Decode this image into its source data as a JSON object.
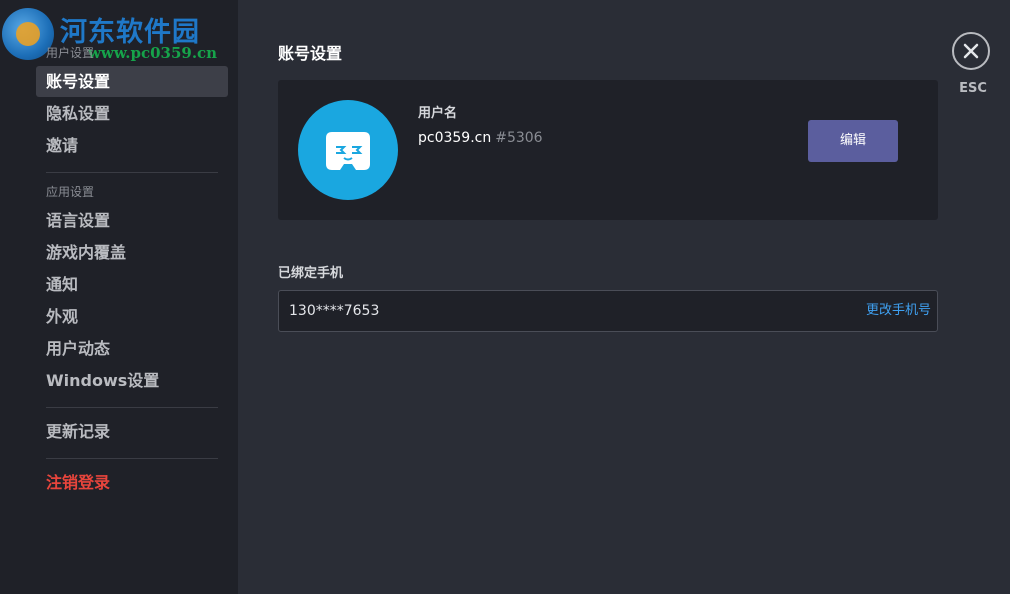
{
  "watermark": {
    "title": "河东软件园",
    "url": "www.pc0359.cn"
  },
  "sidebar": {
    "user_section": "用户设置",
    "app_section": "应用设置",
    "items": [
      {
        "label": "账号设置"
      },
      {
        "label": "隐私设置"
      },
      {
        "label": "邀请"
      },
      {
        "label": "语言设置"
      },
      {
        "label": "游戏内覆盖"
      },
      {
        "label": "通知"
      },
      {
        "label": "外观"
      },
      {
        "label": "用户动态"
      },
      {
        "label": "Windows设置"
      },
      {
        "label": "更新记录"
      },
      {
        "label": "注销登录"
      }
    ]
  },
  "main": {
    "title": "账号设置",
    "profile": {
      "username_label": "用户名",
      "username": "pc0359.cn",
      "discriminator": "#5306",
      "edit_label": "编辑"
    },
    "phone": {
      "label": "已绑定手机",
      "value": "130****7653",
      "change_label": "更改手机号"
    },
    "esc_label": "ESC"
  },
  "colors": {
    "sidebar_bg": "#1f2128",
    "main_bg": "#2a2d36",
    "accent_button": "#5b5e9e",
    "avatar_bg": "#1aa7e0",
    "link": "#3fa0f0",
    "danger": "#e8453c"
  }
}
